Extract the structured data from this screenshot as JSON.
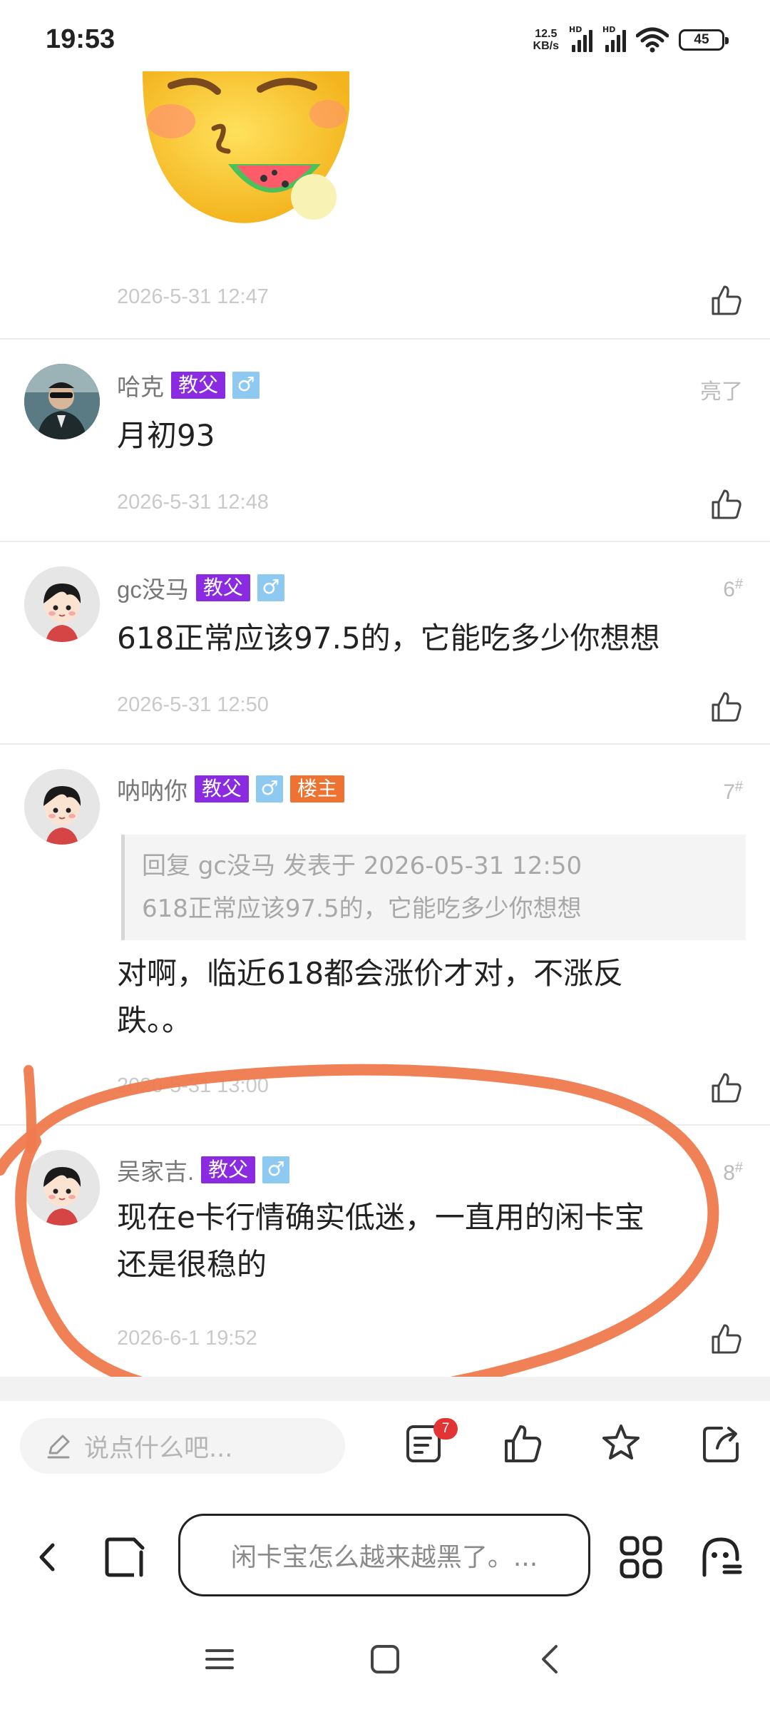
{
  "status_bar": {
    "time": "19:53",
    "net_speed_value": "12.5",
    "net_speed_unit": "KB/s",
    "signal1_label": "HD",
    "signal2_label": "HD",
    "battery": "45"
  },
  "top_post": {
    "date": "2026-5-31 12:47",
    "sticker_icon": "eating-watermelon-emoji"
  },
  "posts": [
    {
      "username": "哈克",
      "badges": [
        "教父"
      ],
      "gender": "♂",
      "floor_label": "亮了",
      "content": "月初93",
      "date": "2026-5-31 12:48"
    },
    {
      "username": "gc没马",
      "badges": [
        "教父"
      ],
      "gender": "♂",
      "floor_num": "6",
      "floor_mark": "#",
      "content": "618正常应该97.5的，它能吃多少你想想",
      "date": "2026-5-31 12:50"
    },
    {
      "username": "呐呐你",
      "badges": [
        "教父"
      ],
      "gender": "♂",
      "owner_badge": "楼主",
      "floor_num": "7",
      "floor_mark": "#",
      "quote_header": "回复 gc没马 发表于 2026-05-31 12:50",
      "quote_body": "618正常应该97.5的，它能吃多少你想想",
      "content_line1": "对啊，临近618都会涨价才对，不涨反",
      "content_line2": "跌。。",
      "date": "2026-5-31 13:00"
    },
    {
      "username": "吴家吉.",
      "badges": [
        "教父"
      ],
      "gender": "♂",
      "floor_num": "8",
      "floor_mark": "#",
      "content_line1": "现在e卡行情确实低迷，一直用的闲卡宝",
      "content_line2": "还是很稳的",
      "date": "2026-6-1 19:52"
    }
  ],
  "action_bar": {
    "comment_placeholder": "说点什么吧...",
    "comment_count": "7",
    "icons": [
      "edit-icon",
      "comments-icon",
      "like-icon",
      "favorite-icon",
      "share-icon"
    ]
  },
  "browser": {
    "address_text": "闲卡宝怎么越来越黑了。...",
    "icons": [
      "back-icon",
      "tabs-icon",
      "apps-grid-icon",
      "assistant-icon"
    ]
  },
  "colors": {
    "badge_purple": "#8a2be2",
    "badge_orange": "#ee7232",
    "gender_blue": "#8ec9f2",
    "annotation_circle": "#ef7a4e",
    "notification_red": "#e23434"
  }
}
